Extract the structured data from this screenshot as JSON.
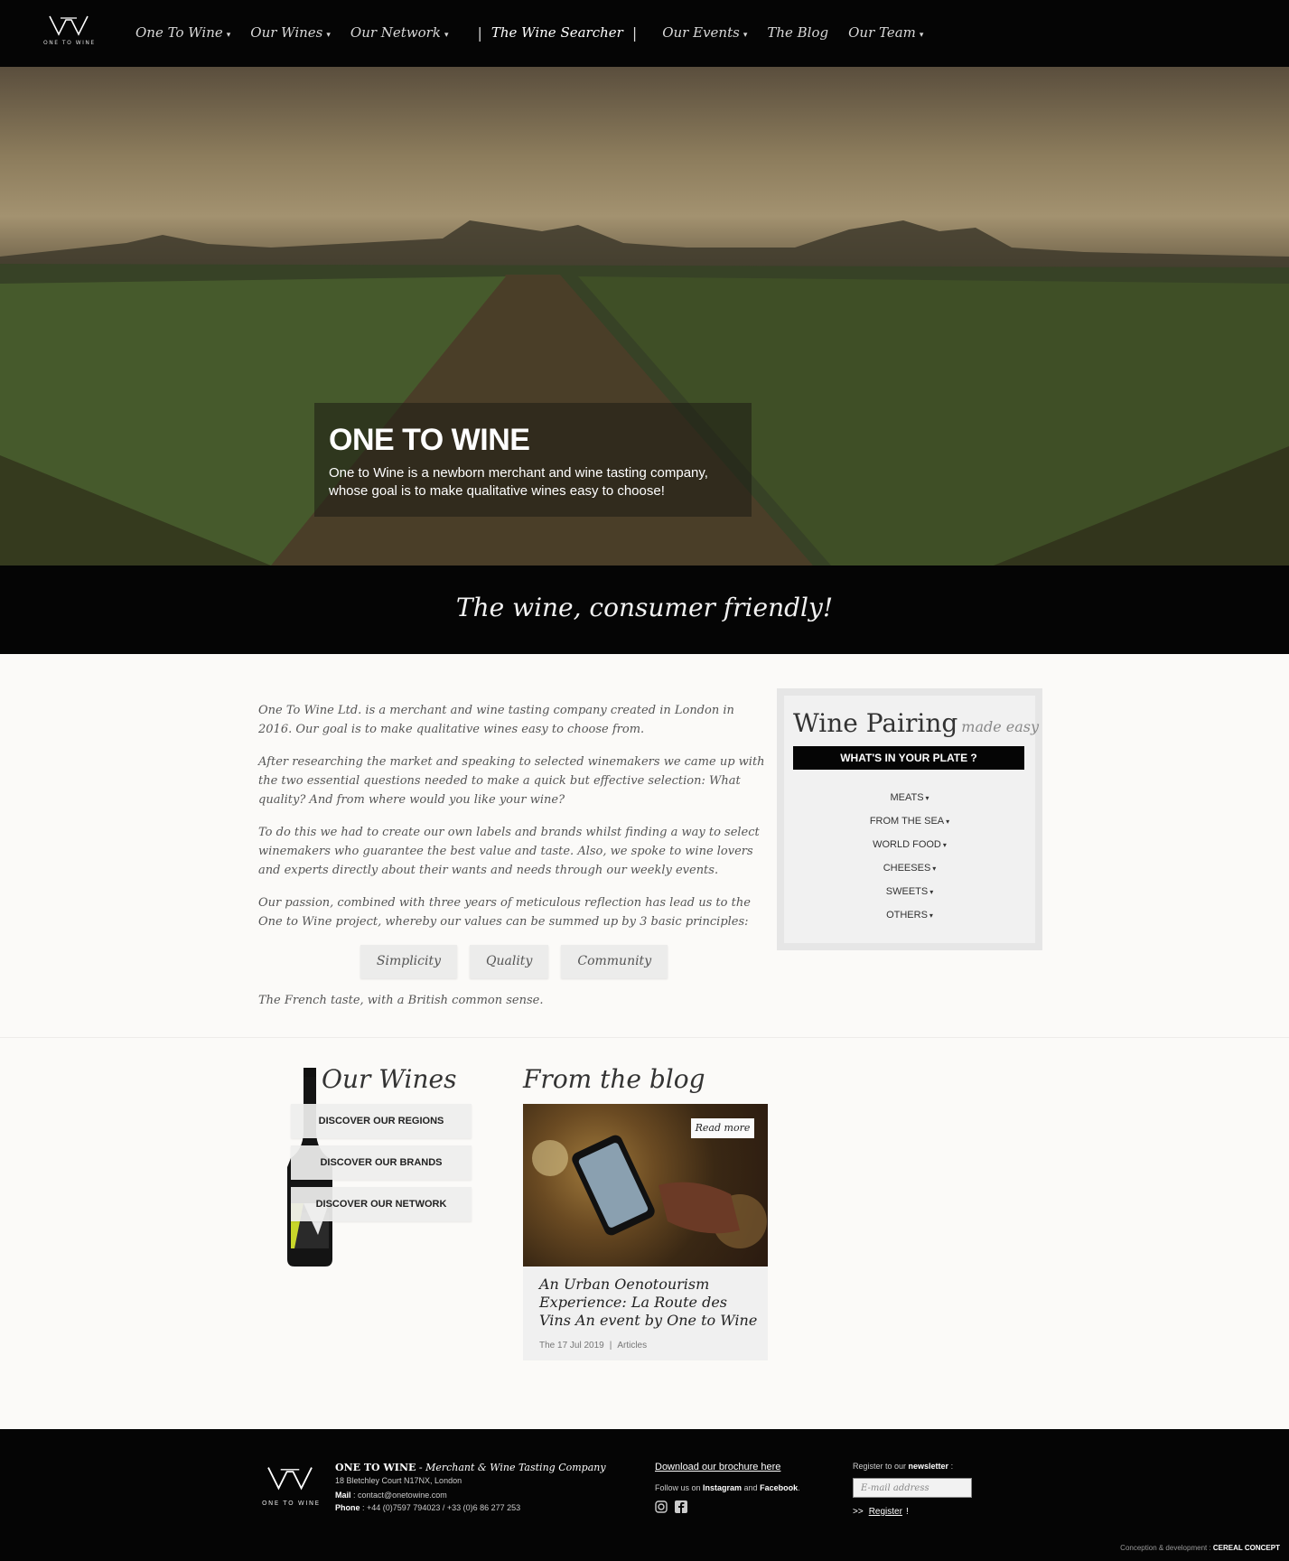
{
  "nav": {
    "logo_text": "ONE TO WINE",
    "items": [
      {
        "label": "One To Wine",
        "caret": "▾"
      },
      {
        "label": "Our Wines",
        "caret": "▾"
      },
      {
        "label": "Our Network",
        "caret": "▾"
      },
      {
        "label": "The Wine Searcher",
        "caret": ""
      },
      {
        "label": "Our Events",
        "caret": "▾"
      },
      {
        "label": "The Blog",
        "caret": ""
      },
      {
        "label": "Our Team",
        "caret": "▾"
      }
    ],
    "separator": "|"
  },
  "hero": {
    "title": "ONE TO WINE",
    "text": "One to Wine is a newborn merchant and wine tasting company, whose goal is to make qualitative wines easy to choose!"
  },
  "tagline": "The wine, consumer friendly!",
  "about": {
    "paragraphs": [
      "One To Wine Ltd. is a merchant and wine tasting company created in London in 2016. Our goal is to make qualitative wines easy to choose from.",
      "After researching the market and speaking to selected winemakers we came up with the two essential questions needed to make a quick but effective selection: What quality? And from where would you like your wine?",
      "To do this we had to create our own labels and brands whilst finding a way to select winemakers who guarantee the best value and taste. Also, we spoke to wine lovers and experts directly about their wants and needs through our weekly events.",
      "Our passion, combined with three years of meticulous reflection has lead us to the One to Wine project, whereby our values can be summed up by 3 basic principles:"
    ],
    "values": [
      "Simplicity",
      "Quality",
      "Community"
    ],
    "closing": "The French taste, with a British common sense."
  },
  "pairing": {
    "title": "Wine Pairing",
    "subtitle": "made easy",
    "button": "WHAT'S IN YOUR PLATE ?",
    "items": [
      "MEATS",
      "FROM THE SEA",
      "WORLD FOOD",
      "CHEESES",
      "SWEETS",
      "OTHERS"
    ],
    "caret": "▾"
  },
  "wines": {
    "title": "Our Wines",
    "buttons": [
      "DISCOVER OUR REGIONS",
      "DISCOVER OUR BRANDS",
      "DISCOVER OUR NETWORK"
    ]
  },
  "blog": {
    "title": "From the blog",
    "read_more": "Read more",
    "post_title": "An Urban Oenotourism Experience: La Route des Vins An event by One to Wine",
    "date": "The 17 Jul 2019",
    "separator": "|",
    "category": "Articles"
  },
  "footer": {
    "logo_text": "ONE TO WINE",
    "company_name": "ONE TO WINE",
    "company_desc": " - Merchant & Wine Tasting Company",
    "address": "18 Bletchley Court N17NX, London",
    "mail_label": "Mail",
    "mail": " : contact@onetowine.com",
    "phone_label": "Phone",
    "phone": " : +44 (0)7597 794023 / +33 (0)6 86 277 253",
    "brochure": "Download our brochure here",
    "follow_prefix": "Follow us on ",
    "instagram": "Instagram",
    "and": " and ",
    "facebook": "Facebook",
    "follow_suffix": ".",
    "newsletter_prefix": "Register to our ",
    "newsletter_bold": "newsletter",
    "newsletter_suffix": " :",
    "email_placeholder": "E-mail address",
    "register_arrows": ">>",
    "register": "Register",
    "register_excl": "!",
    "credit_prefix": "Conception & development : ",
    "credit_name": "CEREAL CONCEPT"
  },
  "colors": {
    "nav_bg": "#050505",
    "band_bg": "#050505",
    "page_bg": "#fbfaf8",
    "panel_bg": "#f1f1f1"
  }
}
